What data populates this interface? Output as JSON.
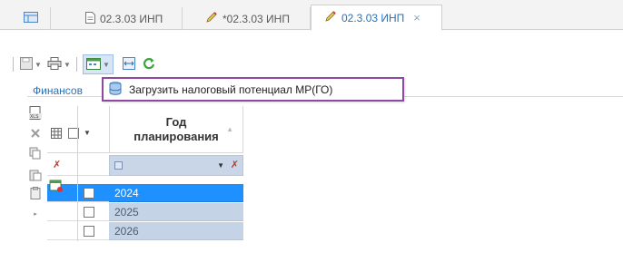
{
  "tabs": [
    {
      "label": "",
      "icon": "grid-view-icon"
    },
    {
      "label": "02.3.03 ИНП",
      "icon": "document-icon"
    },
    {
      "label": "*02.3.03 ИНП",
      "icon": "pencil-icon"
    },
    {
      "label": "02.3.03 ИНП",
      "icon": "pencil-icon",
      "active": true,
      "close": "×"
    }
  ],
  "toolbar": {
    "icons": [
      "save-icon",
      "print-icon",
      "calendar-load-icon",
      "fit-columns-icon",
      "refresh-icon"
    ]
  },
  "popup": {
    "item_label": "Загрузить налоговый потенциал МР(ГО)",
    "icon": "database-icon"
  },
  "section_label": "Финансов",
  "grid": {
    "column_header": "Год планирования",
    "rows": [
      {
        "year": "2024",
        "selected": true
      },
      {
        "year": "2025",
        "selected": false
      },
      {
        "year": "2026",
        "selected": false
      }
    ]
  },
  "colors": {
    "accent": "#2e6fb5",
    "popup_border": "#8e4aa3",
    "selection": "#1e90ff",
    "row_bg": "#c5d3e6"
  }
}
